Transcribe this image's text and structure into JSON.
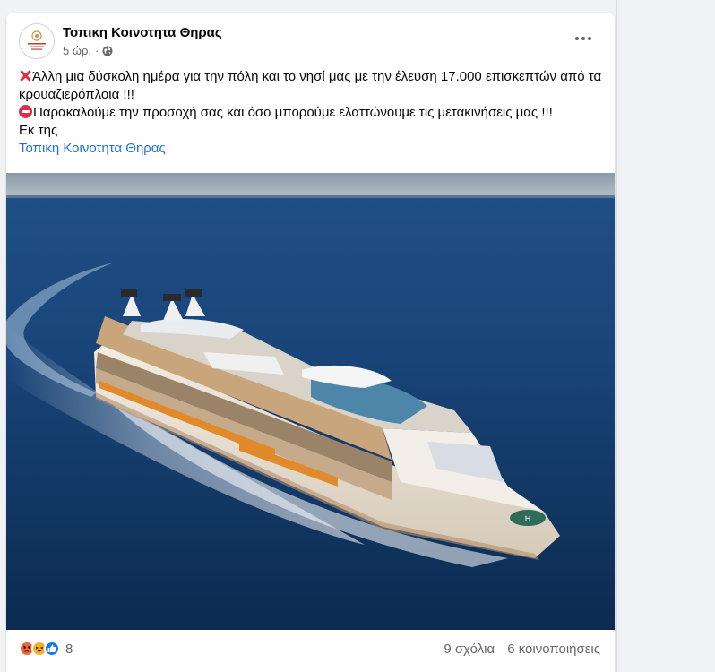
{
  "post": {
    "page_name": "Τοπικη Κοινοτητα Θηρας",
    "time": "5 ώρ.",
    "separator": "·",
    "body": {
      "line1": "Άλλη μια δύσκολη ημέρα για την πόλη και το νησί μας με την έλευση 17.000 επισκεπτών από τα κρουαζιερόπλοια !!!",
      "line2": "Παρακαλούμε την προσοχή σας και όσο μπορούμε ελαττώνουμε τις μετακινήσεις μας !!!",
      "source_prefix": "Εκ της",
      "source_link": "Τοπικη Κοινοτητα Θηρας"
    },
    "footer": {
      "reaction_count": "8",
      "comments": "9 σχόλια",
      "shares": "6 κοινοποιήσεις"
    }
  },
  "icons": {
    "globe": "globe-icon",
    "more": "more-horizontal-icon",
    "cross": "cross-mark-icon",
    "no_entry": "no-entry-icon",
    "angry": "angry-reaction-icon",
    "haha": "haha-reaction-icon",
    "like": "like-reaction-icon"
  },
  "colors": {
    "link": "#216fdb",
    "meta_text": "#65676b",
    "like_blue": "#1877f2",
    "angry_orange": "#f0663c",
    "haha_yellow": "#f7b125"
  }
}
